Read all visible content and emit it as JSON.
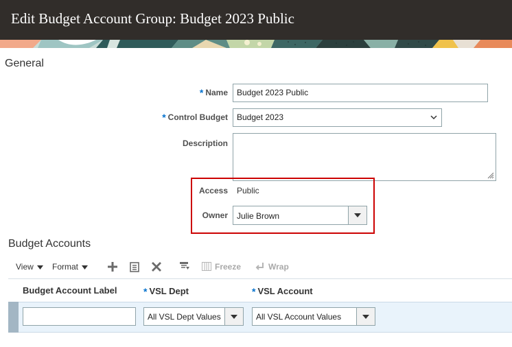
{
  "page": {
    "title": "Edit Budget Account Group: Budget 2023 Public"
  },
  "general": {
    "section_title": "General",
    "required_marker": "*",
    "name": {
      "label": "Name",
      "value": "Budget 2023 Public"
    },
    "control_budget": {
      "label": "Control Budget",
      "value": "Budget 2023"
    },
    "description": {
      "label": "Description",
      "value": ""
    },
    "access": {
      "label": "Access",
      "value": "Public"
    },
    "owner": {
      "label": "Owner",
      "value": "Julie Brown"
    }
  },
  "budget_accounts": {
    "section_title": "Budget Accounts",
    "toolbar": {
      "view_label": "View",
      "format_label": "Format",
      "add_icon": "plus-icon",
      "duplicate_icon": "copy-icon",
      "delete_icon": "close-icon",
      "filter_icon": "detach-icon",
      "freeze_label": "Freeze",
      "wrap_label": "Wrap"
    },
    "columns": [
      {
        "label": "Budget Account Label",
        "required": false
      },
      {
        "label": "VSL Dept",
        "required": true
      },
      {
        "label": "VSL Account",
        "required": true
      }
    ],
    "row": {
      "label_value": "",
      "dept_value": "All VSL Dept Values",
      "account_value": "All VSL Account Values"
    }
  },
  "colors": {
    "title_bar": "#312d2a",
    "required": "#0572ce",
    "highlight": "#cc0000",
    "selected_row": "#e9f3fb"
  }
}
